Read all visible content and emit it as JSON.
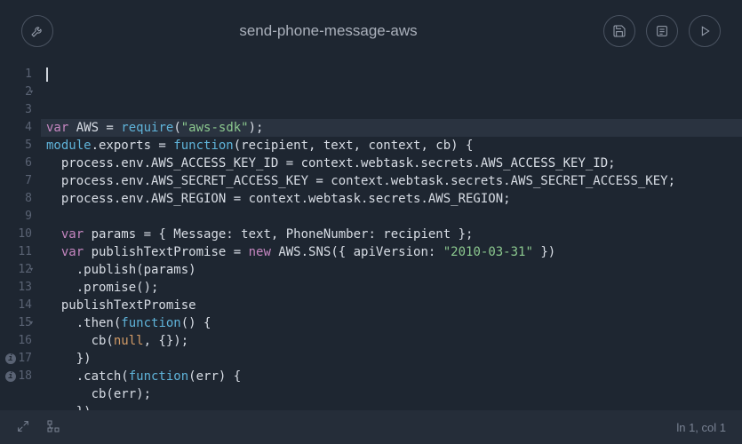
{
  "header": {
    "title": "send-phone-message-aws"
  },
  "editor": {
    "lines": [
      {
        "n": 1,
        "fold": false,
        "info": false,
        "highlight": true,
        "tokens": [
          {
            "t": "var ",
            "c": "kw"
          },
          {
            "t": "AWS = ",
            "c": "plain"
          },
          {
            "t": "require",
            "c": "fn"
          },
          {
            "t": "(",
            "c": "punc"
          },
          {
            "t": "\"aws-sdk\"",
            "c": "str"
          },
          {
            "t": ");",
            "c": "punc"
          }
        ]
      },
      {
        "n": 2,
        "fold": true,
        "info": false,
        "tokens": [
          {
            "t": "module",
            "c": "fn"
          },
          {
            "t": ".exports = ",
            "c": "plain"
          },
          {
            "t": "function",
            "c": "fn"
          },
          {
            "t": "(recipient, text, context, cb) {",
            "c": "plain"
          }
        ]
      },
      {
        "n": 3,
        "fold": false,
        "info": false,
        "tokens": [
          {
            "t": "  process.env.AWS_ACCESS_KEY_ID = context.webtask.secrets.AWS_ACCESS_KEY_ID;",
            "c": "plain"
          }
        ]
      },
      {
        "n": 4,
        "fold": false,
        "info": false,
        "tokens": [
          {
            "t": "  process.env.AWS_SECRET_ACCESS_KEY = context.webtask.secrets.AWS_SECRET_ACCESS_KEY;",
            "c": "plain"
          }
        ]
      },
      {
        "n": 5,
        "fold": false,
        "info": false,
        "tokens": [
          {
            "t": "  process.env.AWS_REGION = context.webtask.secrets.AWS_REGION;",
            "c": "plain"
          }
        ]
      },
      {
        "n": 6,
        "fold": false,
        "info": false,
        "tokens": []
      },
      {
        "n": 7,
        "fold": false,
        "info": false,
        "tokens": [
          {
            "t": "  ",
            "c": "plain"
          },
          {
            "t": "var ",
            "c": "kw"
          },
          {
            "t": "params = { Message: text, PhoneNumber: recipient };",
            "c": "plain"
          }
        ]
      },
      {
        "n": 8,
        "fold": false,
        "info": false,
        "tokens": [
          {
            "t": "  ",
            "c": "plain"
          },
          {
            "t": "var ",
            "c": "kw"
          },
          {
            "t": "publishTextPromise = ",
            "c": "plain"
          },
          {
            "t": "new ",
            "c": "kw"
          },
          {
            "t": "AWS.SNS({ apiVersion: ",
            "c": "plain"
          },
          {
            "t": "\"2010-03-31\"",
            "c": "str"
          },
          {
            "t": " })",
            "c": "plain"
          }
        ]
      },
      {
        "n": 9,
        "fold": false,
        "info": false,
        "tokens": [
          {
            "t": "    .publish(params)",
            "c": "plain"
          }
        ]
      },
      {
        "n": 10,
        "fold": false,
        "info": false,
        "tokens": [
          {
            "t": "    .promise();",
            "c": "plain"
          }
        ]
      },
      {
        "n": 11,
        "fold": false,
        "info": false,
        "tokens": [
          {
            "t": "  publishTextPromise",
            "c": "plain"
          }
        ]
      },
      {
        "n": 12,
        "fold": true,
        "info": false,
        "tokens": [
          {
            "t": "    .then(",
            "c": "plain"
          },
          {
            "t": "function",
            "c": "fn"
          },
          {
            "t": "() {",
            "c": "plain"
          }
        ]
      },
      {
        "n": 13,
        "fold": false,
        "info": false,
        "tokens": [
          {
            "t": "      cb(",
            "c": "plain"
          },
          {
            "t": "null",
            "c": "const"
          },
          {
            "t": ", {});",
            "c": "plain"
          }
        ]
      },
      {
        "n": 14,
        "fold": false,
        "info": false,
        "tokens": [
          {
            "t": "    })",
            "c": "plain"
          }
        ]
      },
      {
        "n": 15,
        "fold": true,
        "info": false,
        "tokens": [
          {
            "t": "    .catch(",
            "c": "plain"
          },
          {
            "t": "function",
            "c": "fn"
          },
          {
            "t": "(err) {",
            "c": "plain"
          }
        ]
      },
      {
        "n": 16,
        "fold": false,
        "info": false,
        "tokens": [
          {
            "t": "      cb(err);",
            "c": "plain"
          }
        ]
      },
      {
        "n": 17,
        "fold": false,
        "info": true,
        "tokens": [
          {
            "t": "    })",
            "c": "plain"
          }
        ]
      },
      {
        "n": 18,
        "fold": false,
        "info": true,
        "tokens": [
          {
            "t": "}",
            "c": "plain"
          }
        ]
      }
    ]
  },
  "status": {
    "position": "ln 1, col 1"
  }
}
